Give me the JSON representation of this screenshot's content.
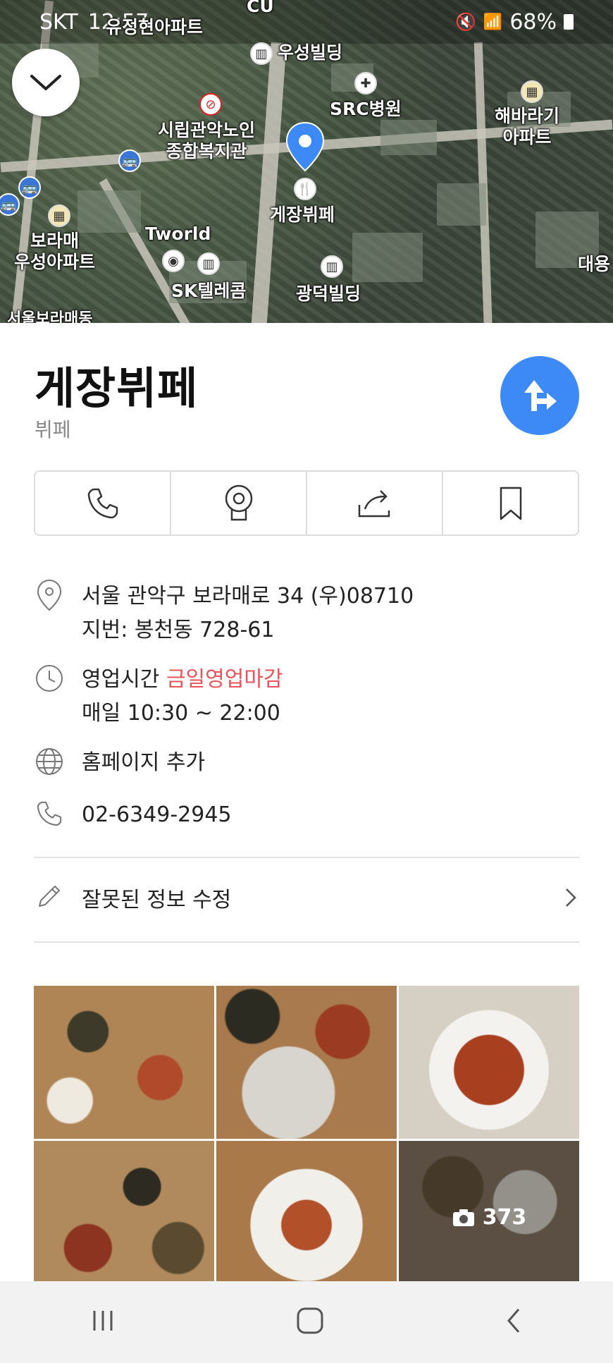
{
  "status": {
    "carrier": "SKT",
    "time": "12:57",
    "battery": "68%"
  },
  "map": {
    "labels": {
      "apt_top": "유정현아파트",
      "woosung_bldg": "우성빌딩",
      "src_hospital": "SRC병원",
      "sunflower_apt": "해바라기\n아파트",
      "senior_center": "시립관악노인\n종합복지관",
      "place_pin": "게장뷔페",
      "boramae_apt": "보라매\n우성아파트",
      "tworld": "Tworld",
      "sk_telecom": "SK텔레콤",
      "gwangdeok_bldg": "광덕빌딩",
      "daeyong": "대용",
      "bottom_left": "서울보라매동",
      "cu": "CU"
    }
  },
  "place": {
    "name": "게장뷔페",
    "category": "뷔페"
  },
  "info": {
    "address": "서울 관악구 보라매로 34 (우)08710",
    "jibun": "지번: 봉천동 728-61",
    "hours_label": "영업시간",
    "hours_status": "금일영업마감",
    "hours_detail": "매일 10:30 ~ 22:00",
    "homepage": "홈페이지 추가",
    "phone": "02-6349-2945",
    "edit": "잘못된 정보 수정"
  },
  "photos": {
    "count": "373"
  },
  "colors": {
    "accent": "#3d8af7",
    "closed": "#e8545a",
    "link": "#2b82e0"
  },
  "icons": {
    "actions": [
      "phone-icon",
      "street-view-icon",
      "share-icon",
      "bookmark-icon"
    ],
    "info": [
      "location-pin-icon",
      "clock-icon",
      "globe-icon",
      "phone-icon",
      "pencil-icon"
    ]
  }
}
